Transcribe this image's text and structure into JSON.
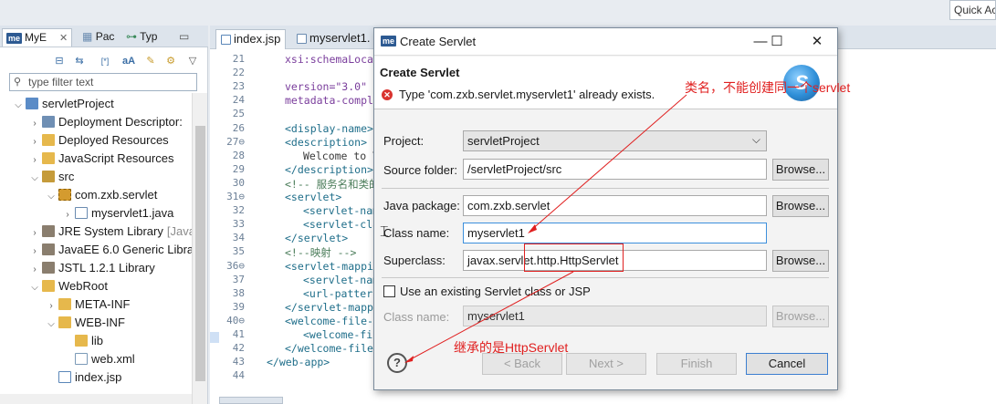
{
  "quick_access": "Quick Ac",
  "explorer": {
    "tabs": [
      {
        "badge": "me",
        "label": "MyE"
      },
      {
        "label": "Pac"
      },
      {
        "label": "Typ"
      }
    ],
    "filter_placeholder": "type filter text",
    "tree": [
      {
        "label": "servletProject",
        "depth": 0,
        "twisty": "open",
        "icon": "proj"
      },
      {
        "label": "Deployment Descriptor:",
        "depth": 1,
        "twisty": "closed",
        "icon": "dd"
      },
      {
        "label": "Deployed Resources",
        "depth": 1,
        "twisty": "closed",
        "icon": "folder"
      },
      {
        "label": "JavaScript Resources",
        "depth": 1,
        "twisty": "closed",
        "icon": "folder"
      },
      {
        "label": "src",
        "depth": 1,
        "twisty": "open",
        "icon": "src"
      },
      {
        "label": "com.zxb.servlet",
        "depth": 2,
        "twisty": "open",
        "icon": "pkg"
      },
      {
        "label": "myservlet1.java",
        "depth": 3,
        "twisty": "closed",
        "icon": "java"
      },
      {
        "label": "JRE System Library",
        "suffix": "[Java",
        "depth": 1,
        "twisty": "closed",
        "icon": "lib"
      },
      {
        "label": "JavaEE 6.0 Generic Libra",
        "depth": 1,
        "twisty": "closed",
        "icon": "lib"
      },
      {
        "label": "JSTL 1.2.1 Library",
        "depth": 1,
        "twisty": "closed",
        "icon": "lib"
      },
      {
        "label": "WebRoot",
        "depth": 1,
        "twisty": "open",
        "icon": "folder"
      },
      {
        "label": "META-INF",
        "depth": 2,
        "twisty": "closed",
        "icon": "folder"
      },
      {
        "label": "WEB-INF",
        "depth": 2,
        "twisty": "open",
        "icon": "folder"
      },
      {
        "label": "lib",
        "depth": 3,
        "twisty": "none",
        "icon": "folder"
      },
      {
        "label": "web.xml",
        "depth": 3,
        "twisty": "none",
        "icon": "xml"
      },
      {
        "label": "index.jsp",
        "depth": 2,
        "twisty": "none",
        "icon": "jsp"
      }
    ]
  },
  "editor": {
    "tabs": [
      {
        "label": "index.jsp"
      },
      {
        "label": "myservlet1."
      }
    ],
    "lines": [
      {
        "n": "21",
        "text": "xsi:schemaLocatio",
        "indent": 1,
        "cls": "k-attr"
      },
      {
        "n": "22",
        "text": "",
        "indent": 0,
        "cls": ""
      },
      {
        "n": "23",
        "text": "version=\"3.0\"",
        "indent": 1,
        "cls": "k-attr"
      },
      {
        "n": "24",
        "text": "metadata-complete",
        "indent": 1,
        "cls": "k-attr"
      },
      {
        "n": "25",
        "text": "",
        "indent": 0,
        "cls": ""
      },
      {
        "n": "26",
        "text": "<display-name>Wel",
        "indent": 1,
        "cls": "k-tag"
      },
      {
        "n": "27⊖",
        "text": "<description>",
        "indent": 1,
        "cls": "k-tag"
      },
      {
        "n": "28",
        "text": "Welcome to Tom",
        "indent": 2,
        "cls": ""
      },
      {
        "n": "29",
        "text": "</description>",
        "indent": 1,
        "cls": "k-tag"
      },
      {
        "n": "30",
        "text": "<!-- 服务名和类的部署 -",
        "indent": 1,
        "cls": "k-com"
      },
      {
        "n": "31⊖",
        "text": "<servlet>",
        "indent": 1,
        "cls": "k-tag"
      },
      {
        "n": "32",
        "text": "<servlet-name>",
        "indent": 2,
        "cls": "k-tag"
      },
      {
        "n": "33",
        "text": "<servlet-class",
        "indent": 2,
        "cls": "k-tag"
      },
      {
        "n": "34",
        "text": "</servlet>",
        "indent": 1,
        "cls": "k-tag"
      },
      {
        "n": "35",
        "text": "<!--映射 -->",
        "indent": 1,
        "cls": "k-com"
      },
      {
        "n": "36⊖",
        "text": "<servlet-mapping>",
        "indent": 1,
        "cls": "k-tag"
      },
      {
        "n": "37",
        "text": "<servlet-name>",
        "indent": 2,
        "cls": "k-tag"
      },
      {
        "n": "38",
        "text": "<url-pattern>/",
        "indent": 2,
        "cls": "k-tag"
      },
      {
        "n": "39",
        "text": "</servlet-mapping",
        "indent": 1,
        "cls": "k-tag"
      },
      {
        "n": "40⊖",
        "text": "<welcome-file-lis",
        "indent": 1,
        "cls": "k-tag"
      },
      {
        "n": "41",
        "text": "<welcome-file>",
        "indent": 2,
        "cls": "k-tag"
      },
      {
        "n": "42",
        "text": "</welcome-file-li",
        "indent": 1,
        "cls": "k-tag"
      },
      {
        "n": "43",
        "text": "</web-app>",
        "indent": 0,
        "cls": "k-tag"
      },
      {
        "n": "44",
        "text": "",
        "indent": 0,
        "cls": ""
      }
    ]
  },
  "dialog": {
    "window_title": "Create Servlet",
    "badge": "me",
    "header_title": "Create Servlet",
    "error_message": "Type 'com.zxb.servlet.myservlet1' already exists.",
    "fields": {
      "project_label": "Project:",
      "project_value": "servletProject",
      "source_folder_label": "Source folder:",
      "source_folder_value": "/servletProject/src",
      "java_package_label": "Java package:",
      "java_package_value": "com.zxb.servlet",
      "class_name_label": "Class name:",
      "class_name_value": "myservlet1",
      "superclass_label": "Superclass:",
      "superclass_value": "javax.servlet.http.HttpServlet",
      "existing_checkbox_label": "Use an existing Servlet class or JSP",
      "existing_class_label": "Class name:",
      "existing_class_value": "myservlet1"
    },
    "buttons": {
      "browse": "Browse...",
      "back": "< Back",
      "next": "Next >",
      "finish": "Finish",
      "cancel": "Cancel"
    }
  },
  "annotations": {
    "class_name_note": "类名，不能创建同一个servlet",
    "superclass_note": "继承的是HttpServlet",
    "color": "#e02020"
  }
}
